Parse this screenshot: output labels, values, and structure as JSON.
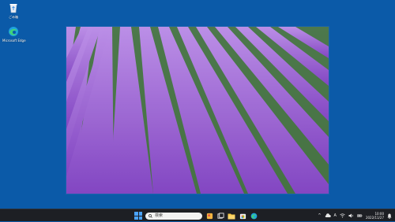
{
  "desktop": {
    "background_color": "#0b5aa8",
    "icons": [
      {
        "label": "ごみ箱",
        "icon": "recycle-bin-icon"
      },
      {
        "label": "Microsoft Edge",
        "icon": "edge-icon"
      }
    ]
  },
  "wallpaper": {
    "subject": "lavender-field-rows",
    "colors": {
      "flower": "#8d53c8",
      "flower_light": "#b98be6",
      "grass": "#3f7a35"
    }
  },
  "taskbar": {
    "search_label": "検索",
    "pinned_icons": [
      "start-icon",
      "widgets-icon",
      "task-view-icon",
      "file-explorer-icon",
      "store-icon",
      "edge-icon"
    ],
    "tray": {
      "overflow_glyph": "^",
      "ime_glyph": "A",
      "time": "10:00",
      "date": "2022/11/27"
    },
    "accent_color": "#4aa3ff"
  }
}
